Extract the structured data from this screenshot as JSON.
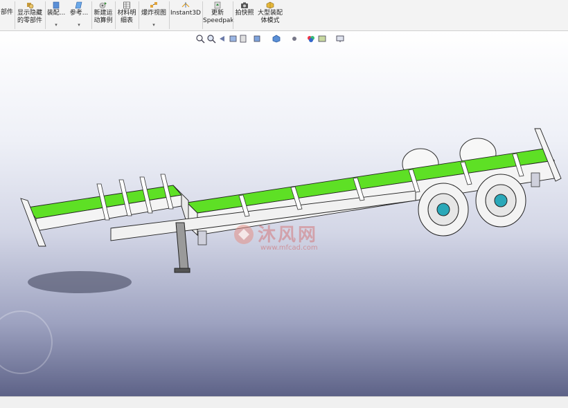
{
  "toolbar": {
    "parts_label": "部件",
    "show_hidden_label_1": "显示隐藏",
    "show_hidden_label_2": "的零部件",
    "assembly_label": "装配...",
    "reference_label": "参考...",
    "new_motion_label_1": "新建运",
    "new_motion_label_2": "动算例",
    "bom_label_1": "材料明",
    "bom_label_2": "细表",
    "explode_label": "爆炸视图",
    "instant3d_label": "Instant3D",
    "update_speedpak_label_1": "更新",
    "update_speedpak_label_2": "Speedpak",
    "snapshot_label": "拍快照",
    "large_assembly_label_1": "大型装配",
    "large_assembly_label_2": "体模式",
    "dropdown_glyph": "▾"
  },
  "watermark": {
    "text_cn": "沐风网",
    "text_url": "www.mfcad.com"
  },
  "colors": {
    "frame_green": "#5ee025",
    "frame_white": "#f4f4f4"
  }
}
